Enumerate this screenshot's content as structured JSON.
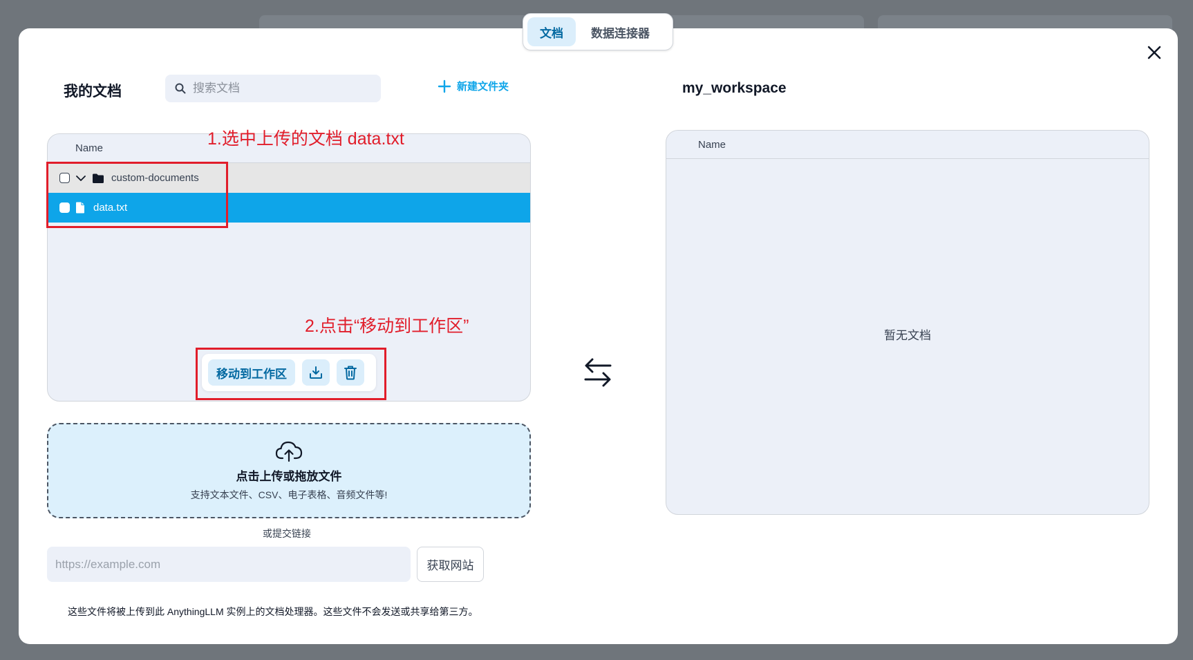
{
  "tabs": [
    {
      "label": "文档",
      "active": true
    },
    {
      "label": "数据连接器",
      "active": false
    }
  ],
  "left": {
    "title": "我的文档",
    "search_placeholder": "搜索文档",
    "new_folder_label": "新建文件夹",
    "column_name": "Name",
    "rows": [
      {
        "type": "folder",
        "label": "custom-documents",
        "expanded": true
      },
      {
        "type": "file",
        "label": "data.txt",
        "selected": true
      }
    ],
    "actions": {
      "move_label": "移动到工作区"
    }
  },
  "annotations": {
    "step1": "1.选中上传的文档 data.txt",
    "step2": "2.点击“移动到工作区”"
  },
  "upload": {
    "title": "点击上传或拖放文件",
    "subtitle": "支持文本文件、CSV、电子表格、音频文件等!",
    "or_link": "或提交链接",
    "url_placeholder": "https://example.com",
    "fetch_label": "获取网站",
    "footnote": "这些文件将被上传到此 AnythingLLM 实例上的文档处理器。这些文件不会发送或共享给第三方。"
  },
  "workspace": {
    "title": "my_workspace",
    "column_name": "Name",
    "empty_text": "暂无文档"
  },
  "colors": {
    "accent": "#0ea5e9",
    "annotation": "#e11d2a",
    "selected_row": "#0ea5e9",
    "panel_bg": "#ecf0f8"
  }
}
